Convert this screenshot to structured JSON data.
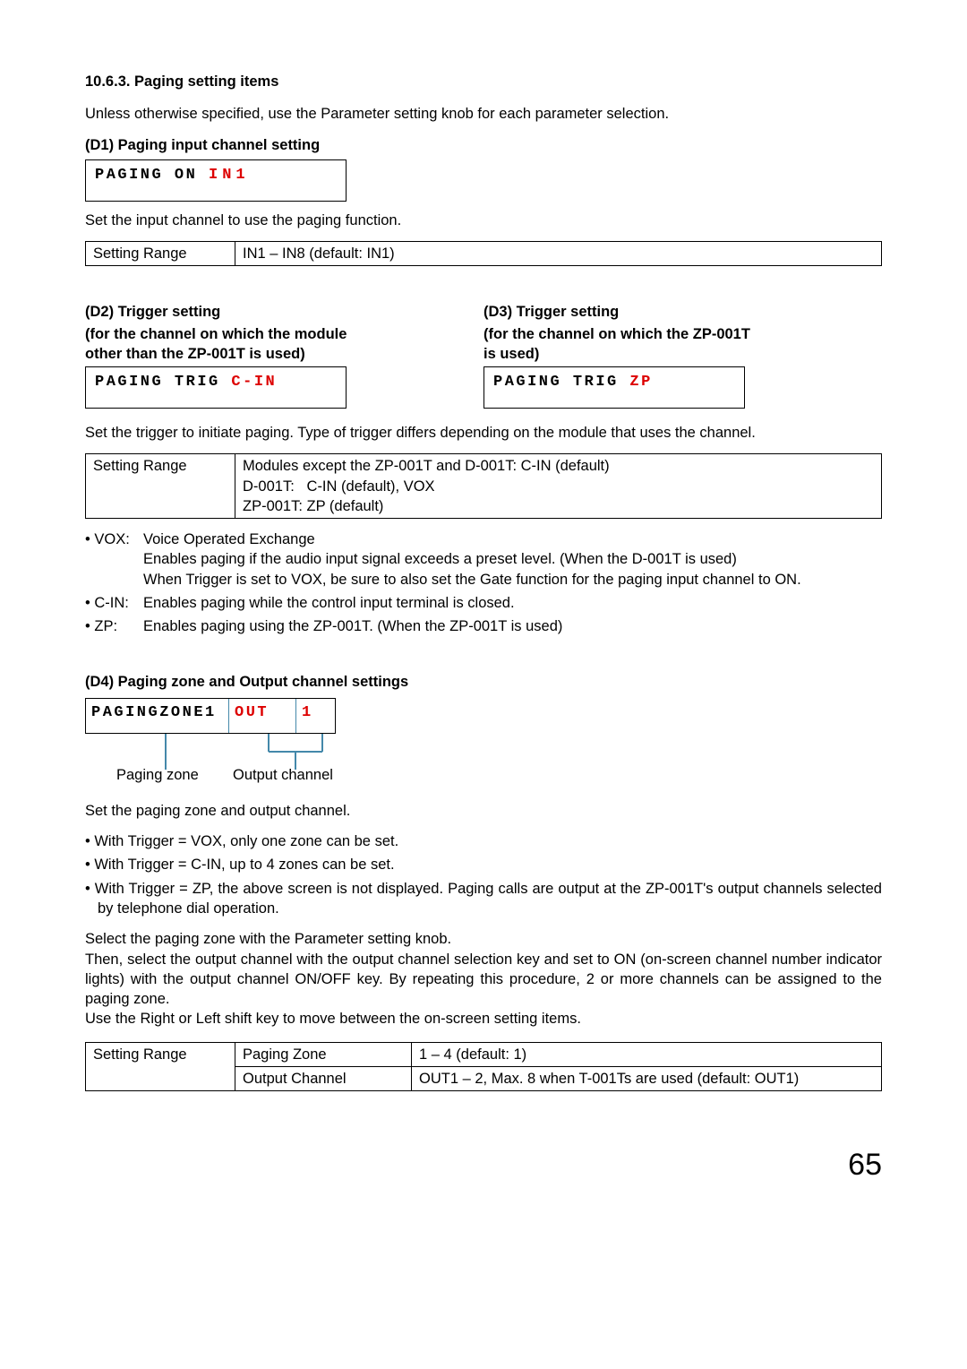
{
  "section_heading": "10.6.3. Paging setting items",
  "intro": "Unless otherwise specified, use the Parameter setting knob for each parameter selection.",
  "d1": {
    "heading": "(D1) Paging input channel setting",
    "lcd_prefix": "PAGING ON",
    "lcd_value": "IN1",
    "desc": "Set the input channel to use the paging function.",
    "range_label": "Setting Range",
    "range_value": "IN1 – IN8 (default: IN1)"
  },
  "d2": {
    "heading": "(D2) Trigger setting",
    "sub1": "(for the channel on which the module",
    "sub2": " other than the ZP-001T is used)",
    "lcd_prefix": "PAGING TRIG",
    "lcd_value": "C-IN"
  },
  "d3": {
    "heading": "(D3) Trigger setting",
    "sub1": "(for the channel on which the ZP-001T",
    "sub2": " is used)",
    "lcd_prefix": "PAGING TRIG",
    "lcd_value": "ZP"
  },
  "trigger_desc": "Set the trigger to initiate paging. Type of trigger differs depending on the module that uses the channel.",
  "trigger_range": {
    "label": "Setting Range",
    "line1": "Modules except the ZP-001T and D-001T: C-IN (default)",
    "line2": "D-001T:   C-IN (default), VOX",
    "line3": "ZP-001T: ZP (default)"
  },
  "vox_label": "• VOX:",
  "vox_text1": "Voice Operated Exchange",
  "vox_text2": "Enables paging if the audio input signal exceeds a preset level. (When the D-001T is used)",
  "vox_text3": "When Trigger is set to VOX, be sure to also set the Gate function for the paging input channel to ON.",
  "cin_label": "• C-IN:",
  "cin_text": "Enables paging while the control input terminal is closed.",
  "zp_label": "• ZP:",
  "zp_text": "Enables paging using the ZP-001T. (When the ZP-001T is used)",
  "d4": {
    "heading": "(D4) Paging zone and Output channel settings",
    "lcd_label": "PAGINGZONE",
    "lcd_zonenum": "1",
    "lcd_out": "OUT",
    "lcd_outnum": "1",
    "caption_zone": "Paging zone",
    "caption_out": "Output channel"
  },
  "d4_desc": "Set the paging zone and output channel.",
  "d4_b1": "• With Trigger  = VOX, only one zone can be set.",
  "d4_b2": "• With Trigger  = C-IN, up to 4 zones can be set.",
  "d4_b3": "• With Trigger = ZP, the above screen is not displayed. Paging calls are output at the ZP-001T's output channels selected by telephone dial operation.",
  "d4_p1": "Select the paging zone with the Parameter setting knob.",
  "d4_p2": "Then, select the output channel with the output channel selection key and set to ON (on-screen channel number indicator lights) with the output channel ON/OFF key. By repeating this procedure, 2 or more channels can be assigned to the paging zone.",
  "d4_p3": "Use the Right or Left shift key to move between the on-screen setting items.",
  "d4_range": {
    "label": "Setting Range",
    "row1_param": "Paging Zone",
    "row1_val": "1 – 4 (default: 1)",
    "row2_param": "Output Channel",
    "row2_val": "OUT1 – 2, Max. 8 when T-001Ts are used (default: OUT1)"
  },
  "page_number": "65"
}
